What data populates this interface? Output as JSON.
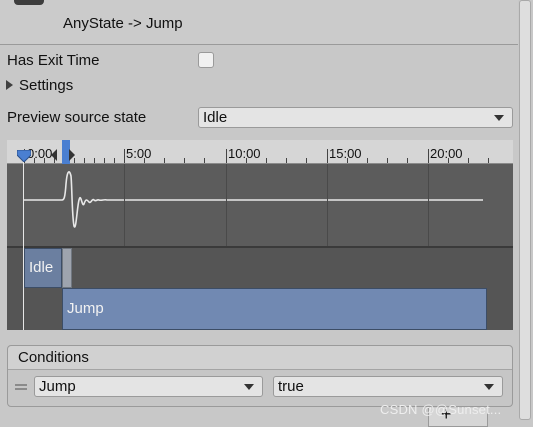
{
  "header": {
    "title": "AnyState -> Jump",
    "icon": "gear-icon"
  },
  "settings": {
    "has_exit_time_label": "Has Exit Time",
    "has_exit_time_checked": false,
    "settings_foldout_label": "Settings",
    "preview_source_label": "Preview source state",
    "preview_source_value": "Idle"
  },
  "timeline": {
    "ruler_labels": [
      "0:00",
      "5:00",
      "10:00",
      "15:00",
      "20:00"
    ],
    "source_state": "Idle",
    "destination_state": "Jump"
  },
  "conditions": {
    "title": "Conditions",
    "rows": [
      {
        "parameter": "Jump",
        "value": "true"
      }
    ],
    "add_label": "+"
  },
  "watermark": "CSDN @@Sunset...",
  "colors": {
    "background": "#c8c8c8",
    "timeline_bg": "#5e5e5e",
    "source_bar": "#6b7fa0",
    "destination_bar": "#7189b2",
    "playhead_marker": "#4a7fd1"
  }
}
